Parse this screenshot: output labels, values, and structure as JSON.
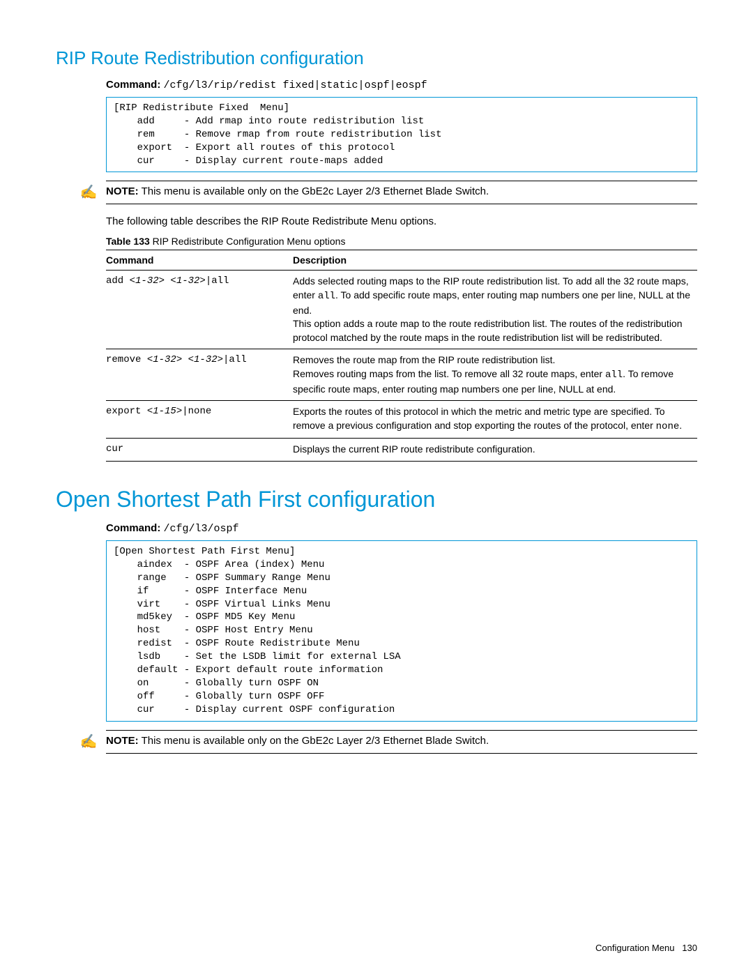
{
  "section1": {
    "heading": "RIP Route Redistribution configuration",
    "command_label": "Command:",
    "command_path": "/cfg/l3/rip/redist fixed|static|ospf|eospf",
    "code_box": "[RIP Redistribute Fixed  Menu]\n    add     - Add rmap into route redistribution list\n    rem     - Remove rmap from route redistribution list\n    export  - Export all routes of this protocol\n    cur     - Display current route-maps added",
    "note_label": "NOTE:",
    "note_text": "This menu is available only on the GbE2c Layer 2/3 Ethernet Blade Switch.",
    "body_text": "The following table describes the RIP Route Redistribute Menu options.",
    "table_caption_label": "Table 133",
    "table_caption_text": "RIP Redistribute Configuration Menu options",
    "table_headers": {
      "c1": "Command",
      "c2": "Description"
    },
    "rows": [
      {
        "cmd_prefix": "add ",
        "cmd_args": "<1-32> <1-32>",
        "cmd_suffix": "|all",
        "desc_pre": "Adds selected routing maps to the RIP route redistribution list. To add all the 32 route maps, enter ",
        "mono": "all",
        "desc_mid": ". To add specific route maps, enter routing map numbers one per line, NULL at the end.",
        "desc_post": "This option adds a route map to the route redistribution list. The routes of the redistribution protocol matched by the route maps in the route redistribution list will be redistributed."
      },
      {
        "cmd_prefix": "remove ",
        "cmd_args": "<1-32> <1-32>",
        "cmd_suffix": "|all",
        "desc_line1": "Removes the route map from the RIP route redistribution list.",
        "desc_pre": "Removes routing maps from the list. To remove all 32 route maps, enter ",
        "mono": "all",
        "desc_post": ". To remove specific route maps, enter routing map numbers one per line, NULL at end."
      },
      {
        "cmd_prefix": "export ",
        "cmd_args": "<1-15>",
        "cmd_suffix": "|none",
        "desc_pre": "Exports the routes of this protocol in which the metric and metric type are specified. To remove a previous configuration and stop exporting the routes of the protocol, enter ",
        "mono": "none",
        "desc_post": "."
      },
      {
        "cmd": "cur",
        "desc": "Displays the current RIP route redistribute configuration."
      }
    ]
  },
  "section2": {
    "heading": "Open Shortest Path First configuration",
    "command_label": "Command:",
    "command_path": "/cfg/l3/ospf",
    "code_box": "[Open Shortest Path First Menu]\n    aindex  - OSPF Area (index) Menu\n    range   - OSPF Summary Range Menu\n    if      - OSPF Interface Menu\n    virt    - OSPF Virtual Links Menu\n    md5key  - OSPF MD5 Key Menu\n    host    - OSPF Host Entry Menu\n    redist  - OSPF Route Redistribute Menu\n    lsdb    - Set the LSDB limit for external LSA\n    default - Export default route information\n    on      - Globally turn OSPF ON\n    off     - Globally turn OSPF OFF\n    cur     - Display current OSPF configuration",
    "note_label": "NOTE:",
    "note_text": "This menu is available only on the GbE2c Layer 2/3 Ethernet Blade Switch."
  },
  "footer": {
    "section": "Configuration Menu",
    "page": "130"
  }
}
